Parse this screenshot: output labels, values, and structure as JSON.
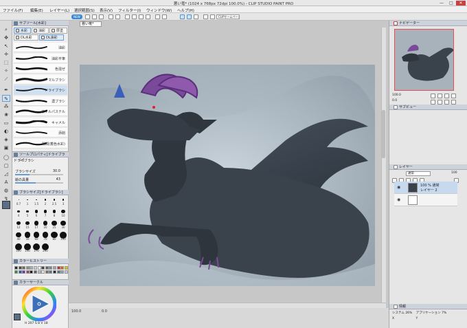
{
  "window": {
    "title": "悪い竜* (1024 x 768px 72dpi 100.0%)  -  CLIP STUDIO PAINT PRO",
    "minimize": "—",
    "maximize": "□",
    "close": "✕"
  },
  "menu": [
    "ファイル(F)",
    "編集(E)",
    "レイヤー(L)",
    "選択範囲(S)",
    "表示(V)",
    "フィルター(I)",
    "ウィンドウ(W)",
    "ヘルプ(H)"
  ],
  "cmdbar": {
    "badge": "NEW",
    "clip_label": "CLIPホームページ"
  },
  "document_tab": "悪い竜*",
  "subtool": {
    "header": "サブツール[水彩]",
    "tabs": [
      "水彩",
      "油彩",
      "厚塗",
      "DL水彩",
      "DL油彩"
    ],
    "brushes": [
      {
        "name": "油彩"
      },
      {
        "name": "油彩平筆"
      },
      {
        "name": "色混ぜ"
      },
      {
        "name": "ノーマルブラシ"
      },
      {
        "name": "ドライブラシ"
      },
      {
        "name": "濃ブラシ"
      },
      {
        "name": "オイルパステル"
      },
      {
        "name": "キャメル"
      },
      {
        "name": "添削"
      },
      {
        "name": "隙間(着色水彩)"
      }
    ],
    "selected_index": 4
  },
  "tool_property": {
    "header": "ツールプロパティ[ドライブラシ]",
    "tool_name": "ドライブラシ",
    "brush_size_label": "ブラシサイズ",
    "brush_size_value": "30.0",
    "brush_size_fraction": 0.3,
    "density_label": "絵の具量",
    "density_value": "43",
    "density_fraction": 0.43
  },
  "brush_size_panel": {
    "header": "ブラシサイズ[ドライブラシ]",
    "sizes": [
      "0.7",
      "1",
      "1.5",
      "2",
      "2.5",
      "3",
      "4",
      "5",
      "6",
      "7",
      "8",
      "10",
      "12",
      "15",
      "17",
      "20",
      "25",
      "30",
      "40",
      "50",
      "60",
      "70",
      "80",
      "100",
      "120",
      "150",
      "170",
      "200"
    ]
  },
  "color_set": {
    "header": "カラーヒストリー",
    "swatches": [
      "#2b2b2b",
      "#4a4a4a",
      "#6b6b6b",
      "#8d8d8d",
      "#adadad",
      "#cfcfcf",
      "#ffffff",
      "#3e4655",
      "#5b6674",
      "#7b8593",
      "#9aa4b0",
      "#c03030",
      "#d46a00",
      "#e0c000",
      "#3a8a3a",
      "#2a5aa8",
      "#6a3aa0",
      "#a04070",
      "#1e1e1e",
      "#556070",
      "#b0bcc8",
      "#e8e8e8",
      "#8a6a4a",
      "#4a7a9a",
      "#202830",
      "#607080",
      "#90a0b0",
      "#c0c8d0"
    ]
  },
  "color_wheel": {
    "header": "カラーサークル",
    "hsv": "H 207  S 8  V 18",
    "fg_color": "#5a6e88",
    "bg_color": "#ffffff"
  },
  "status": {
    "zoom": "100.0",
    "angle": "0.0"
  },
  "navigator": {
    "header": "ナビゲーター",
    "zoom": "100.0",
    "angle": "0.0"
  },
  "subview": {
    "header": "サブビュー"
  },
  "layers": {
    "header": "レイヤー",
    "blend_mode": "通常",
    "opacity": "100",
    "items": [
      {
        "line1": "100 %  通常",
        "line2": "レイヤー 2"
      },
      {
        "line1": "",
        "line2": ""
      }
    ]
  },
  "info_panel": {
    "header": "情報",
    "system_label": "システム",
    "system_value": "26%",
    "app_label": "アプリケーション",
    "app_value": "7%",
    "line2_label": "X",
    "line2_value": "Y"
  }
}
